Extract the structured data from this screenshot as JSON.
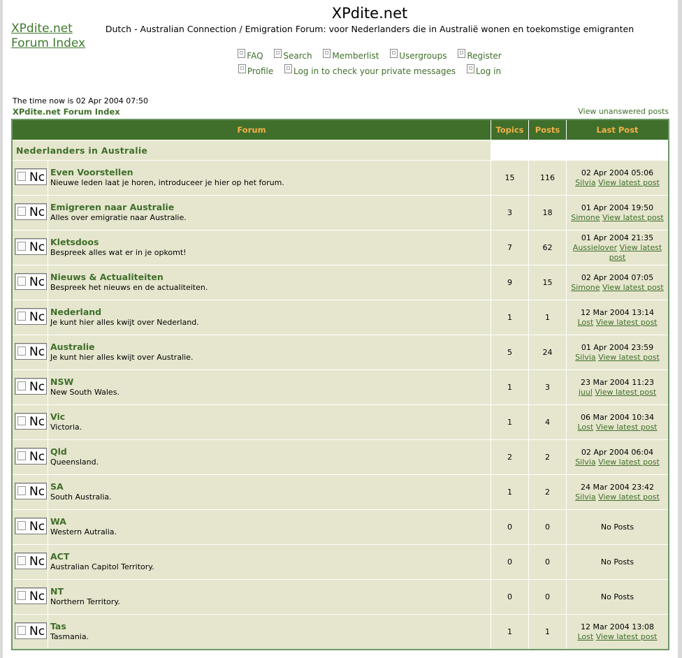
{
  "header": {
    "logo_link": "XPdite.net Forum Index",
    "site_title": "XPdite.net",
    "site_description": "Dutch - Australian Connection / Emigration Forum: voor Nederlanders die in Australië wonen en toekomstige emigranten"
  },
  "nav": {
    "row1": [
      {
        "label": "FAQ"
      },
      {
        "label": "Search"
      },
      {
        "label": "Memberlist"
      },
      {
        "label": "Usergroups"
      },
      {
        "label": "Register"
      }
    ],
    "row2": [
      {
        "label": "Profile"
      },
      {
        "label": "Log in to check your private messages"
      },
      {
        "label": "Log in"
      }
    ]
  },
  "status": {
    "time_now": "The time now is 02 Apr 2004 07:50",
    "index_link": "XPdite.net Forum Index",
    "unanswered_link": "View unanswered posts"
  },
  "table": {
    "headers": {
      "forum": "Forum",
      "topics": "Topics",
      "posts": "Posts",
      "last_post": "Last Post"
    },
    "category": "Nederlanders in Australie",
    "icon_text": "Nc",
    "view_latest": "View latest post",
    "forums": [
      {
        "name": "Even Voorstellen",
        "desc": "Nieuwe leden laat je horen, introduceer je hier op het forum.",
        "topics": "15",
        "posts": "116",
        "last_date": "02 Apr 2004 05:06",
        "last_user": "Silvia"
      },
      {
        "name": "Emigreren naar Australie",
        "desc": "Alles over emigratie naar Australie.",
        "topics": "3",
        "posts": "18",
        "last_date": "01 Apr 2004 19:50",
        "last_user": "Simone"
      },
      {
        "name": "Kletsdoos",
        "desc": "Bespreek alles wat er in je opkomt!",
        "topics": "7",
        "posts": "62",
        "last_date": "01 Apr 2004 21:35",
        "last_user": "Aussielover"
      },
      {
        "name": "Nieuws & Actualiteiten",
        "desc": "Bespreek het nieuws en de actualiteiten.",
        "topics": "9",
        "posts": "15",
        "last_date": "02 Apr 2004 07:05",
        "last_user": "Simone"
      },
      {
        "name": "Nederland",
        "desc": "Je kunt hier alles kwijt over Nederland.",
        "topics": "1",
        "posts": "1",
        "last_date": "12 Mar 2004 13:14",
        "last_user": "Lost"
      },
      {
        "name": "Australie",
        "desc": "Je kunt hier alles kwijt over Australie.",
        "topics": "5",
        "posts": "24",
        "last_date": "01 Apr 2004 23:59",
        "last_user": "Silvia"
      },
      {
        "name": "NSW",
        "desc": "New South Wales.",
        "topics": "1",
        "posts": "3",
        "last_date": "23 Mar 2004 11:23",
        "last_user": "juul"
      },
      {
        "name": "Vic",
        "desc": "Victoria.",
        "topics": "1",
        "posts": "4",
        "last_date": "06 Mar 2004 10:34",
        "last_user": "Lost"
      },
      {
        "name": "Qld",
        "desc": "Queensland.",
        "topics": "2",
        "posts": "2",
        "last_date": "02 Apr 2004 06:04",
        "last_user": "Silvia"
      },
      {
        "name": "SA",
        "desc": "South Australia.",
        "topics": "1",
        "posts": "2",
        "last_date": "24 Mar 2004 23:42",
        "last_user": "Silvia"
      },
      {
        "name": "WA",
        "desc": "Western Autralia.",
        "topics": "0",
        "posts": "0",
        "last_date": "No Posts",
        "last_user": ""
      },
      {
        "name": "ACT",
        "desc": "Australian Capitol Territory.",
        "topics": "0",
        "posts": "0",
        "last_date": "No Posts",
        "last_user": ""
      },
      {
        "name": "NT",
        "desc": "Northern Territory.",
        "topics": "0",
        "posts": "0",
        "last_date": "No Posts",
        "last_user": ""
      },
      {
        "name": "Tas",
        "desc": "Tasmania.",
        "topics": "1",
        "posts": "1",
        "last_date": "12 Mar 2004 13:08",
        "last_user": "Lost"
      }
    ]
  }
}
